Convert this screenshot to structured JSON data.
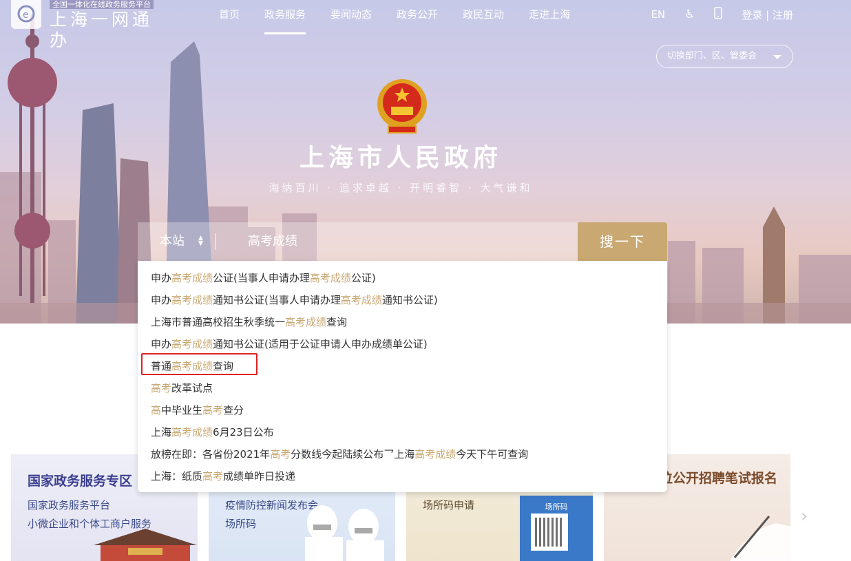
{
  "header": {
    "logo_tag": "全国一体化在线政务服务平台",
    "logo_name": "上海一网通办",
    "nav": [
      "首页",
      "政务服务",
      "要闻动态",
      "政务公开",
      "政民互动",
      "走进上海"
    ],
    "lang": "EN",
    "login": "登录 | 注册",
    "switch_label": "切换部门、区、管委会"
  },
  "hero": {
    "title": "上海市人民政府",
    "slogan": "海纳百川 · 追求卓越 · 开明睿智 · 大气谦和"
  },
  "search": {
    "scope": "本站",
    "query": "高考成绩",
    "button": "搜一下"
  },
  "suggestions": [
    [
      [
        "申办",
        ""
      ],
      [
        "高考成绩",
        "hl"
      ],
      [
        "公证(当事人申请办理",
        ""
      ],
      [
        "高考成绩",
        "hl"
      ],
      [
        "公证)",
        ""
      ]
    ],
    [
      [
        "申办",
        ""
      ],
      [
        "高考成绩",
        "hl"
      ],
      [
        "通知书公证(当事人申请办理",
        ""
      ],
      [
        "高考成绩",
        "hl"
      ],
      [
        "通知书公证)",
        ""
      ]
    ],
    [
      [
        "上海市普通高校招生秋季统一",
        ""
      ],
      [
        "高考成绩",
        "hl"
      ],
      [
        "查询",
        ""
      ]
    ],
    [
      [
        "申办",
        ""
      ],
      [
        "高考成绩",
        "hl"
      ],
      [
        "通知书公证(适用于公证申请人申办成绩单公证)",
        ""
      ]
    ],
    [
      [
        "普通",
        ""
      ],
      [
        "高考成绩",
        "hl"
      ],
      [
        "查询",
        ""
      ]
    ],
    [
      [
        "高考",
        "hl"
      ],
      [
        "改革试点",
        ""
      ]
    ],
    [
      [
        "高",
        "hl"
      ],
      [
        "中毕业生",
        ""
      ],
      [
        "高考",
        "hl"
      ],
      [
        "查分",
        ""
      ]
    ],
    [
      [
        "上海",
        ""
      ],
      [
        "高考成绩",
        "hl"
      ],
      [
        "6月23日公布",
        ""
      ]
    ],
    [
      [
        "放榜在即：各省份2021年",
        ""
      ],
      [
        "高考",
        "hl"
      ],
      [
        "分数线今起陆续公布乛上海",
        ""
      ],
      [
        "高考成绩",
        "hl"
      ],
      [
        "今天下午可查询",
        ""
      ]
    ],
    [
      [
        "上海：纸质",
        ""
      ],
      [
        "高考",
        "hl"
      ],
      [
        "成绩单昨日投递",
        ""
      ]
    ]
  ],
  "cards": {
    "card1": {
      "title": "国家政务服务专区",
      "lines": [
        "国家政务服务平台",
        "小微企业和个体工商户服务"
      ]
    },
    "card2": {
      "lines": [
        "疫情防控新闻发布会",
        "场所码"
      ]
    },
    "card3": {
      "lines": [
        "场所码申请"
      ],
      "qr_label": "场所码"
    },
    "card4": {
      "title": "事业单位公开招聘笔试报名"
    }
  },
  "colors": {
    "accent": "#c9a872",
    "highlight_box": "#e02020"
  }
}
